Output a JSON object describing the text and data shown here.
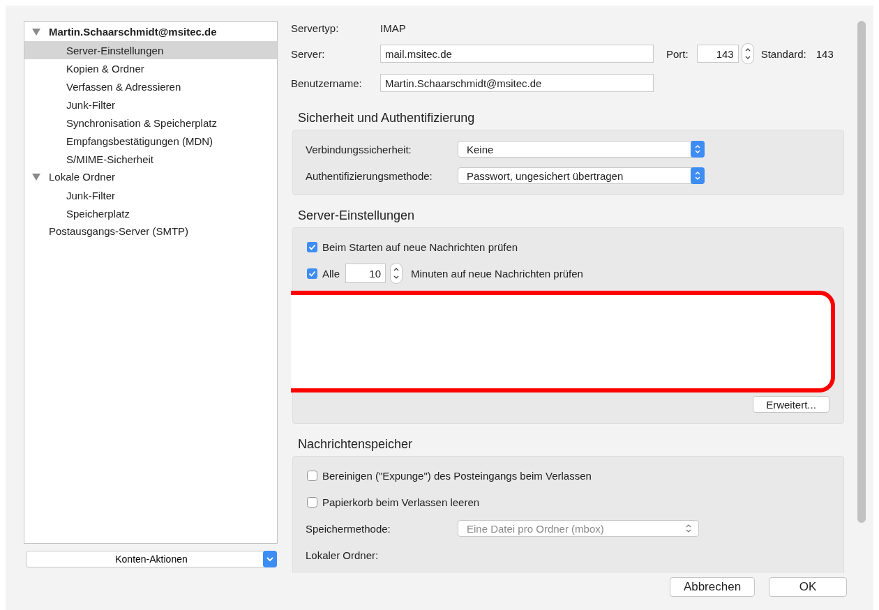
{
  "tree": [
    {
      "label": "Martin.Schaarschmidt@msitec.de",
      "bold": true,
      "expanded": true,
      "selected": false,
      "children": [
        {
          "label": "Server-Einstellungen",
          "selected": true
        },
        {
          "label": "Kopien & Ordner",
          "selected": false
        },
        {
          "label": "Verfassen & Adressieren",
          "selected": false
        },
        {
          "label": "Junk-Filter",
          "selected": false
        },
        {
          "label": "Synchronisation & Speicherplatz",
          "selected": false
        },
        {
          "label": "Empfangsbestätigungen (MDN)",
          "selected": false
        },
        {
          "label": "S/MIME-Sicherheit",
          "selected": false
        }
      ]
    },
    {
      "label": "Lokale Ordner",
      "bold": false,
      "expanded": true,
      "selected": false,
      "children": [
        {
          "label": "Junk-Filter",
          "selected": false
        },
        {
          "label": "Speicherplatz",
          "selected": false
        }
      ]
    },
    {
      "label": "Postausgangs-Server (SMTP)",
      "bold": false,
      "selected": false
    }
  ],
  "account_actions": "Konten-Aktionen",
  "server_info": {
    "type_label": "Servertyp:",
    "type_value": "IMAP",
    "server_label": "Server:",
    "server_value": "mail.msitec.de",
    "port_label": "Port:",
    "port_value": "143",
    "default_label": "Standard:",
    "default_value": "143",
    "user_label": "Benutzername:",
    "user_value": "Martin.Schaarschmidt@msitec.de"
  },
  "sections": [
    {
      "title": "Sicherheit und Authentifizierung",
      "rows": [
        {
          "kind": "select",
          "label": "Verbindungssicherheit:",
          "value": "Keine",
          "disabled": false
        },
        {
          "kind": "select",
          "label": "Authentifizierungsmethode:",
          "value": "Passwort, ungesichert übertragen",
          "disabled": false
        }
      ]
    },
    {
      "title": "Server-Einstellungen",
      "rows": [
        {
          "kind": "checkbox",
          "label": "Beim Starten auf neue Nachrichten prüfen",
          "checked": true
        },
        {
          "kind": "interval",
          "label": "Alle",
          "checked": true,
          "value": "10",
          "suffix": "Minuten auf neue Nachrichten prüfen"
        },
        {
          "kind": "redaction"
        },
        {
          "kind": "button",
          "label": "Erweitert..."
        }
      ]
    },
    {
      "title": "Nachrichtenspeicher",
      "rows": [
        {
          "kind": "checkbox",
          "label": "Bereinigen (\"Expunge\") des Posteingangs beim Verlassen",
          "checked": false
        },
        {
          "kind": "checkbox",
          "label": "Papierkorb beim Verlassen leeren",
          "checked": false
        },
        {
          "kind": "select",
          "label": "Speichermethode:",
          "value": "Eine Datei pro Ordner (mbox)",
          "disabled": true
        },
        {
          "kind": "label",
          "label": "Lokaler Ordner:"
        }
      ]
    }
  ],
  "buttons": [
    {
      "label": "Abbrechen"
    },
    {
      "label": "OK"
    }
  ]
}
